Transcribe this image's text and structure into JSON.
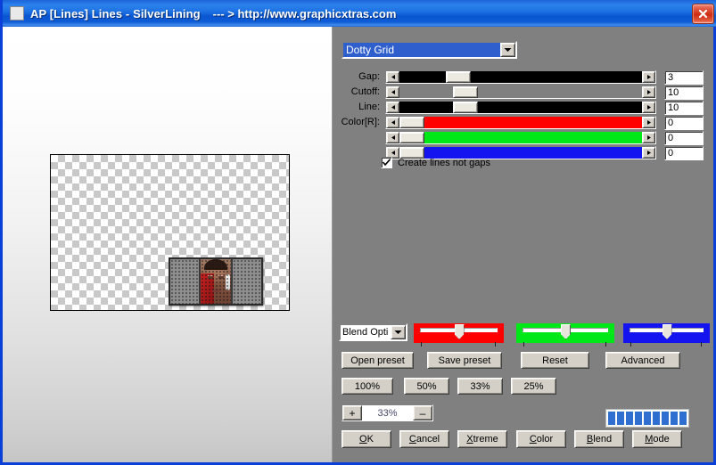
{
  "window": {
    "icon": "app-window-icon",
    "title": "AP [Lines]  Lines - SilverLining",
    "subtitle": "--- > http://www.graphicxtras.com",
    "close_label": "×",
    "accent_blue": "#1b6fe2",
    "close_red": "#cf2d13"
  },
  "preview": {
    "transparency_checker": "checkerboard",
    "artwork_description": "portrait with dotty grid pattern"
  },
  "controls": {
    "preset_combo": {
      "value": "Dotty Grid",
      "arrow_icon": "chevron-down-icon"
    },
    "sliders": [
      {
        "label": "Gap:",
        "value": "3",
        "fill": "#000000",
        "thumb_pct": 19
      },
      {
        "label": "Cutoff:",
        "value": "10",
        "fill": "#808080",
        "thumb_pct": 22
      },
      {
        "label": "Line:",
        "value": "10",
        "fill": "#000000",
        "thumb_pct": 22
      },
      {
        "label": "Color[R]:",
        "value": "0",
        "fill": "#ff0000",
        "thumb_pct": 0
      },
      {
        "label": "",
        "value": "0",
        "fill": "#00e818",
        "thumb_pct": 0
      },
      {
        "label": "",
        "value": "0",
        "fill": "#1414f0",
        "thumb_pct": 0
      }
    ],
    "left_arrow_icon": "arrow-left-icon",
    "right_arrow_icon": "arrow-right-icon",
    "checkbox": {
      "label": "Create lines not gaps",
      "checked": true,
      "check_icon": "checkmark-icon"
    }
  },
  "blend_row": {
    "combo_value": "Blend Opti",
    "arrow_icon": "chevron-down-icon",
    "channels": [
      {
        "name": "red",
        "color": "#ff0000",
        "thumb_pct": 50
      },
      {
        "name": "green",
        "color": "#00e818",
        "thumb_pct": 50
      },
      {
        "name": "blue",
        "color": "#1414f0",
        "thumb_pct": 50
      }
    ]
  },
  "preset_buttons": [
    {
      "label": "Open preset"
    },
    {
      "label": "Save preset"
    },
    {
      "label": "Reset"
    },
    {
      "label": "Advanced"
    }
  ],
  "zoom_buttons": [
    {
      "label": "100%"
    },
    {
      "label": "50%"
    },
    {
      "label": "33%"
    },
    {
      "label": "25%"
    }
  ],
  "stepper": {
    "plus_label": "+",
    "value": "33%",
    "minus_label": "–"
  },
  "progress": {
    "blocks": 9,
    "block_color": "#2f6fcf"
  },
  "action_buttons": [
    {
      "accel": "O",
      "rest": "K"
    },
    {
      "accel": "C",
      "rest": "ancel"
    },
    {
      "accel": "X",
      "rest": "treme"
    },
    {
      "accel": "C",
      "rest": "olor"
    },
    {
      "accel": "B",
      "rest": "lend"
    },
    {
      "accel": "M",
      "rest": "ode"
    }
  ]
}
